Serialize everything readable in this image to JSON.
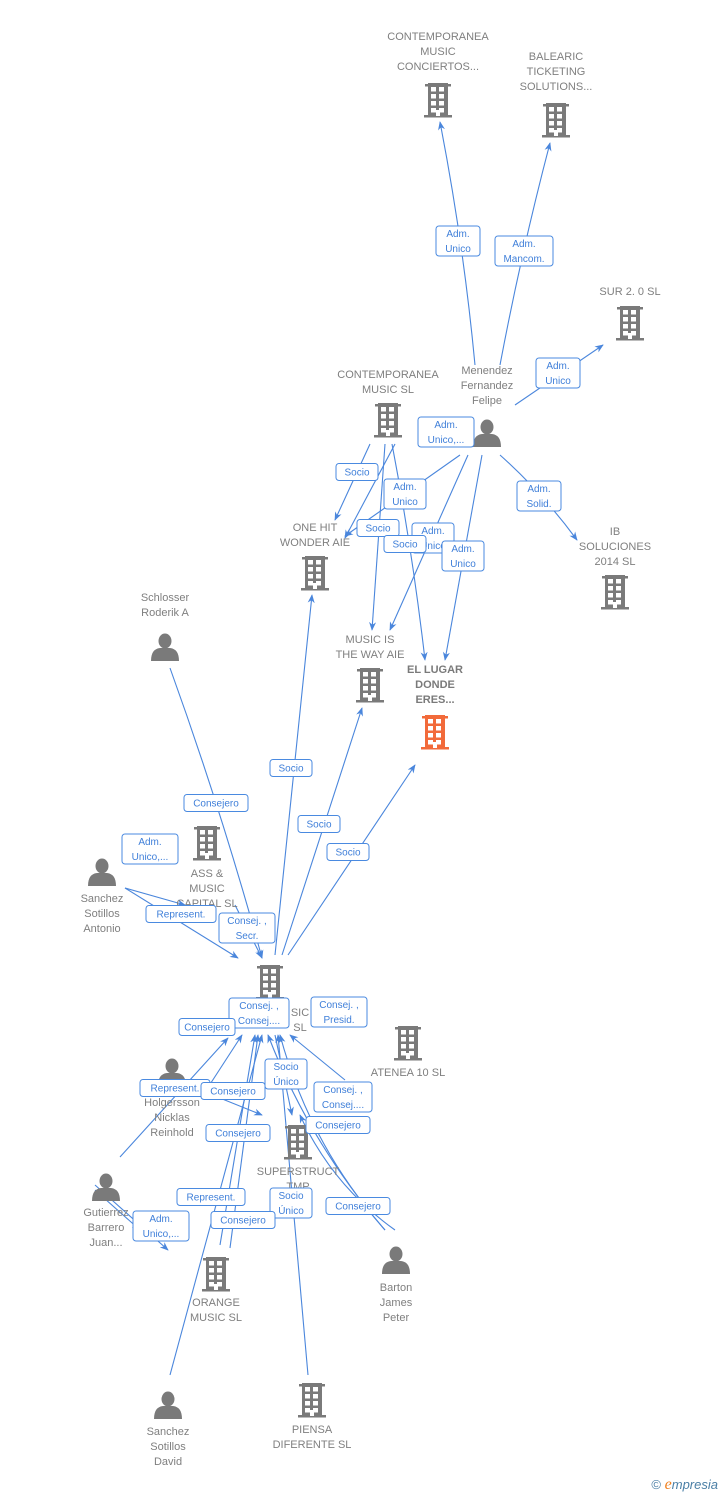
{
  "colors": {
    "edge": "#4a86dc",
    "node": "#7a7a7a",
    "highlight": "#f26a3a",
    "label_text": "#3f7fd9"
  },
  "nodes": [
    {
      "id": "contemporanea_conciertos",
      "type": "company",
      "label": [
        "CONTEMPORANEA",
        "MUSIC",
        "CONCIERTOS..."
      ]
    },
    {
      "id": "balearic",
      "type": "company",
      "label": [
        "BALEARIC",
        "TICKETING",
        "SOLUTIONS..."
      ]
    },
    {
      "id": "sur20",
      "type": "company",
      "label": [
        "SUR 2. 0 SL"
      ]
    },
    {
      "id": "contemporanea_music",
      "type": "company",
      "label": [
        "CONTEMPORANEA",
        "MUSIC  SL"
      ]
    },
    {
      "id": "menendez",
      "type": "person",
      "label": [
        "Menendez",
        "Fernandez",
        "Felipe"
      ]
    },
    {
      "id": "one_hit",
      "type": "company",
      "label": [
        "ONE HIT",
        "WONDER AIE"
      ]
    },
    {
      "id": "ib",
      "type": "company",
      "label": [
        "IB",
        "SOLUCIONES",
        "2014  SL"
      ]
    },
    {
      "id": "music_is",
      "type": "company",
      "label": [
        "MUSIC IS",
        "THE WAY AIE"
      ]
    },
    {
      "id": "el_lugar",
      "type": "company",
      "highlight": true,
      "label": [
        "EL LUGAR",
        "DONDE",
        "ERES..."
      ]
    },
    {
      "id": "schlosser",
      "type": "person",
      "label": [
        "Schlosser",
        "Roderik A"
      ]
    },
    {
      "id": "ass_music",
      "type": "company",
      "label": [
        "ASS &",
        "MUSIC",
        "CAPITAL SL"
      ]
    },
    {
      "id": "sanchez_antonio",
      "type": "person",
      "label": [
        "Sanchez",
        "Sotillos",
        "Antonio"
      ]
    },
    {
      "id": "central",
      "type": "company",
      "label": [
        "SIC",
        "SL"
      ]
    },
    {
      "id": "atenea",
      "type": "company",
      "label": [
        "ATENEA 10 SL"
      ]
    },
    {
      "id": "holgersson",
      "type": "person",
      "label": [
        "Holgersson",
        "Nicklas",
        "Reinhold"
      ]
    },
    {
      "id": "superstruct",
      "type": "company",
      "label": [
        "SUPERSTRUCT",
        "TMP",
        "H              S"
      ]
    },
    {
      "id": "gutierrez",
      "type": "person",
      "label": [
        "Gutierrez",
        "Barrero",
        "Juan..."
      ]
    },
    {
      "id": "barton",
      "type": "person",
      "label": [
        "Barton",
        "James",
        "Peter"
      ]
    },
    {
      "id": "orange",
      "type": "company",
      "label": [
        "ORANGE",
        "MUSIC  SL"
      ]
    },
    {
      "id": "sanchez_david",
      "type": "person",
      "label": [
        "Sanchez",
        "Sotillos",
        "David"
      ]
    },
    {
      "id": "piensa",
      "type": "company",
      "label": [
        "PIENSA",
        "DIFERENTE SL"
      ]
    }
  ],
  "edges": [
    {
      "from": "menendez",
      "to": "contemporanea_conciertos",
      "label": [
        "Adm.",
        "Unico"
      ]
    },
    {
      "from": "menendez",
      "to": "balearic",
      "label": [
        "Adm.",
        "Mancom."
      ]
    },
    {
      "from": "menendez",
      "to": "sur20",
      "label": [
        "Adm.",
        "Unico"
      ]
    },
    {
      "from": "menendez",
      "to": "ib",
      "label": [
        "Adm.",
        "Solid."
      ]
    },
    {
      "from": "menendez",
      "to": "one_hit",
      "label": [
        "Adm.",
        "Unico,..."
      ]
    },
    {
      "from": "contemporanea_music",
      "to": "one_hit",
      "label": [
        "Socio"
      ]
    },
    {
      "from": "contemporanea_music",
      "to": "music_is",
      "label": [
        "Adm.",
        "Unico"
      ]
    },
    {
      "from": "contemporanea_music",
      "to": "one_hit",
      "label": [
        "Socio"
      ]
    },
    {
      "from": "menendez",
      "to": "music_is",
      "label": [
        "Adm.",
        "Unico"
      ]
    },
    {
      "from": "contemporanea_music",
      "to": "el_lugar",
      "label": [
        "Socio"
      ]
    },
    {
      "from": "menendez",
      "to": "el_lugar",
      "label": [
        "Adm.",
        "Unico"
      ]
    },
    {
      "from": "central",
      "to": "one_hit",
      "label": [
        "Socio"
      ]
    },
    {
      "from": "schlosser",
      "to": "central",
      "label": [
        "Consejero"
      ]
    },
    {
      "from": "central",
      "to": "music_is",
      "label": [
        "Socio"
      ]
    },
    {
      "from": "central",
      "to": "el_lugar",
      "label": [
        "Socio"
      ]
    },
    {
      "from": "sanchez_antonio",
      "to": "ass_music",
      "label": [
        "Adm.",
        "Unico,..."
      ]
    },
    {
      "from": "sanchez_antonio",
      "to": "central",
      "label": [
        "Represent."
      ]
    },
    {
      "from": "ass_music",
      "to": "central",
      "label": [
        "Consej. ,",
        "Secr."
      ]
    },
    {
      "from": "orange",
      "to": "central",
      "label": [
        "Consej. ,",
        "Consej...."
      ]
    },
    {
      "from": "barton",
      "to": "central",
      "label": [
        "Consej. ,",
        "Presid."
      ]
    },
    {
      "from": "gutierrez",
      "to": "central",
      "label": [
        "Consejero"
      ]
    },
    {
      "from": "holgersson",
      "to": "central",
      "label": [
        "Represent."
      ]
    },
    {
      "from": "holgersson",
      "to": "superstruct",
      "label": [
        "Consejero"
      ]
    },
    {
      "from": "central",
      "to": "superstruct",
      "label": [
        "Socio",
        "Único"
      ]
    },
    {
      "from": "barton",
      "to": "central",
      "label": [
        "Consej. ,",
        "Consej...."
      ]
    },
    {
      "from": "barton",
      "to": "superstruct",
      "label": [
        "Consejero"
      ]
    },
    {
      "from": "sanchez_david",
      "to": "central",
      "label": [
        "Consejero"
      ]
    },
    {
      "from": "gutierrez",
      "to": "orange",
      "label": [
        "Represent."
      ]
    },
    {
      "from": "piensa",
      "to": "central",
      "label": [
        "Socio",
        "Único"
      ]
    },
    {
      "from": "barton",
      "to": "central",
      "label": [
        "Consejero"
      ]
    },
    {
      "from": "gutierrez",
      "to": "orange",
      "label": [
        "Adm.",
        "Unico,..."
      ]
    },
    {
      "from": "orange",
      "to": "central",
      "label": [
        "Consejero"
      ]
    }
  ],
  "brand": {
    "copyright": "©",
    "name_first": "e",
    "name_rest": "mpresia"
  }
}
